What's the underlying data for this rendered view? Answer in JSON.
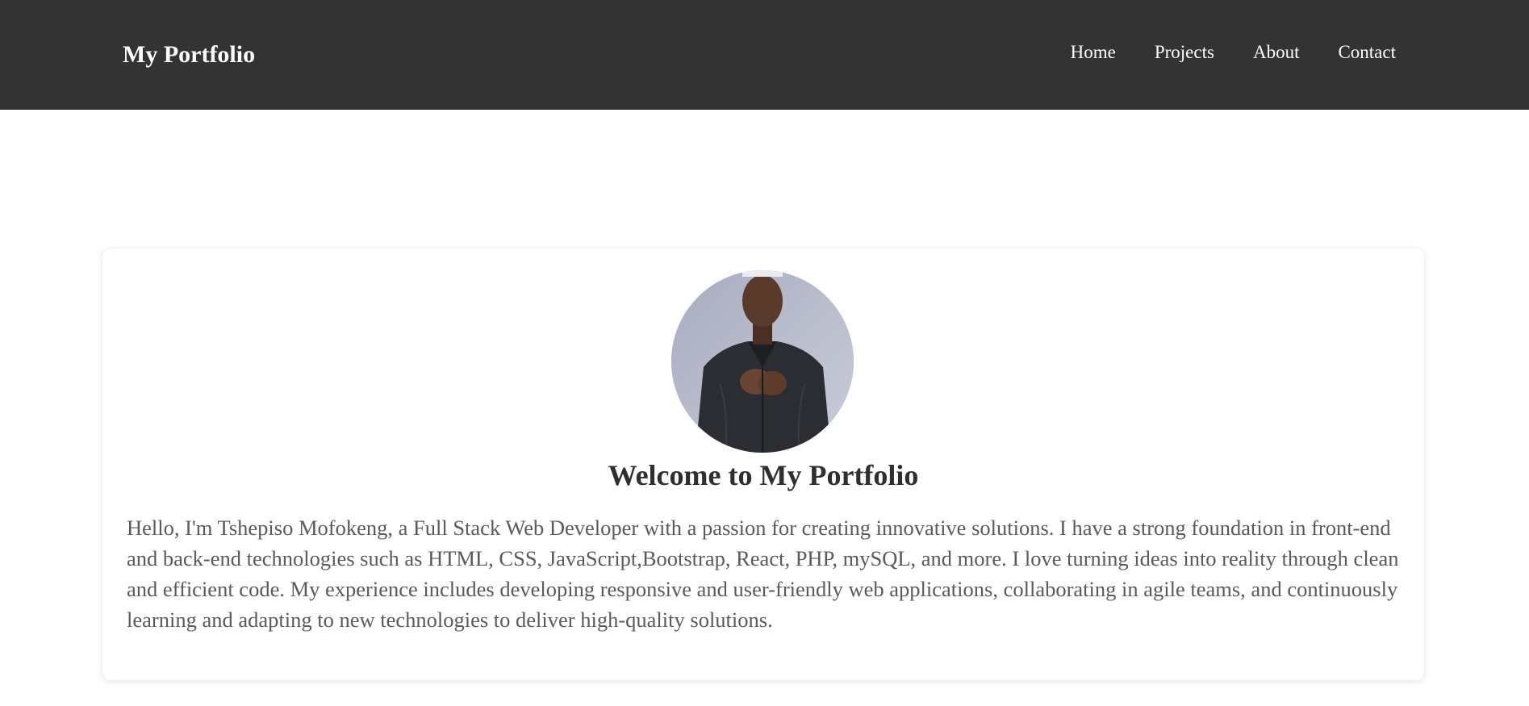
{
  "navbar": {
    "brand": "My Portfolio",
    "links": [
      {
        "label": "Home"
      },
      {
        "label": "Projects"
      },
      {
        "label": "About"
      },
      {
        "label": "Contact"
      }
    ],
    "background_color": "#333333"
  },
  "hero": {
    "title": "Welcome to My Portfolio",
    "intro": "Hello, I'm Tshepiso Mofokeng, a Full Stack Web Developer with a passion for creating innovative solutions. I have a strong foundation in front-end and back-end technologies such as HTML, CSS, JavaScript,Bootstrap, React, PHP, mySQL, and more. I love turning ideas into reality through clean and efficient code. My experience includes developing responsive and user-friendly web applications, collaborating in agile teams, and continuously learning and adapting to new technologies to deliver high-quality solutions.",
    "avatar_icon": "profile-photo"
  }
}
